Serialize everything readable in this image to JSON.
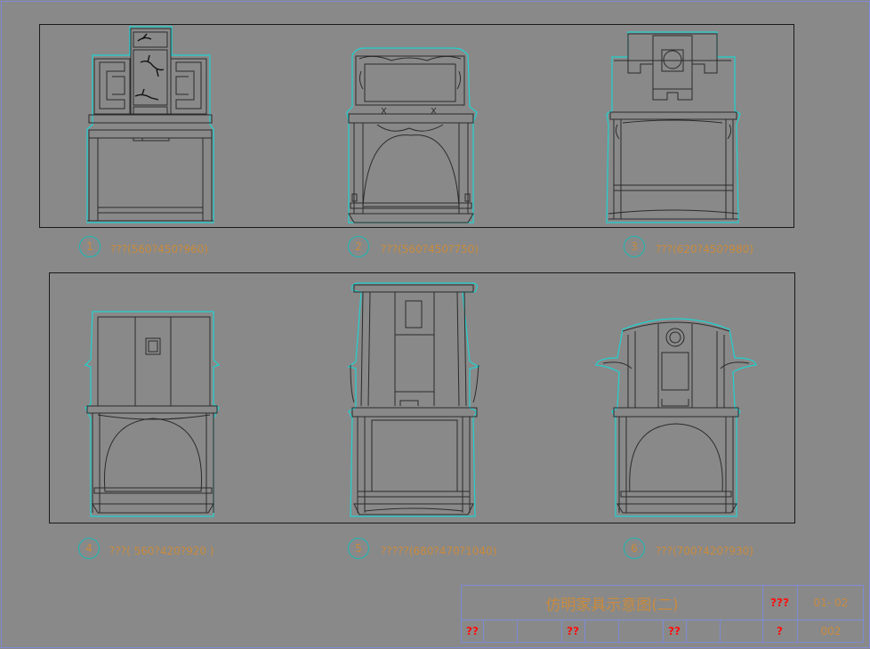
{
  "drawing": {
    "items": [
      {
        "number": "1",
        "caption": "???(560?450?960)"
      },
      {
        "number": "2",
        "caption": "???(560?450?750)"
      },
      {
        "number": "3",
        "caption": "???(620?450?980)"
      },
      {
        "number": "4",
        "caption": "???( 560?420?920 )"
      },
      {
        "number": "5",
        "caption": "?????(680?470?1040)"
      },
      {
        "number": "6",
        "caption": "???(700?420?930)"
      }
    ]
  },
  "title_block": {
    "title": "仿明家具示意图(二)",
    "scale_label": "???",
    "scale_value": "01- 02",
    "row2": [
      "??",
      "??",
      "??",
      "?",
      "002"
    ]
  },
  "colors": {
    "background": "#898989",
    "outline_cyan": "#1fd2d0",
    "text_orange": "#c98a3c",
    "label_red": "#ff1010",
    "frame_blue": "#7d8bd6"
  }
}
